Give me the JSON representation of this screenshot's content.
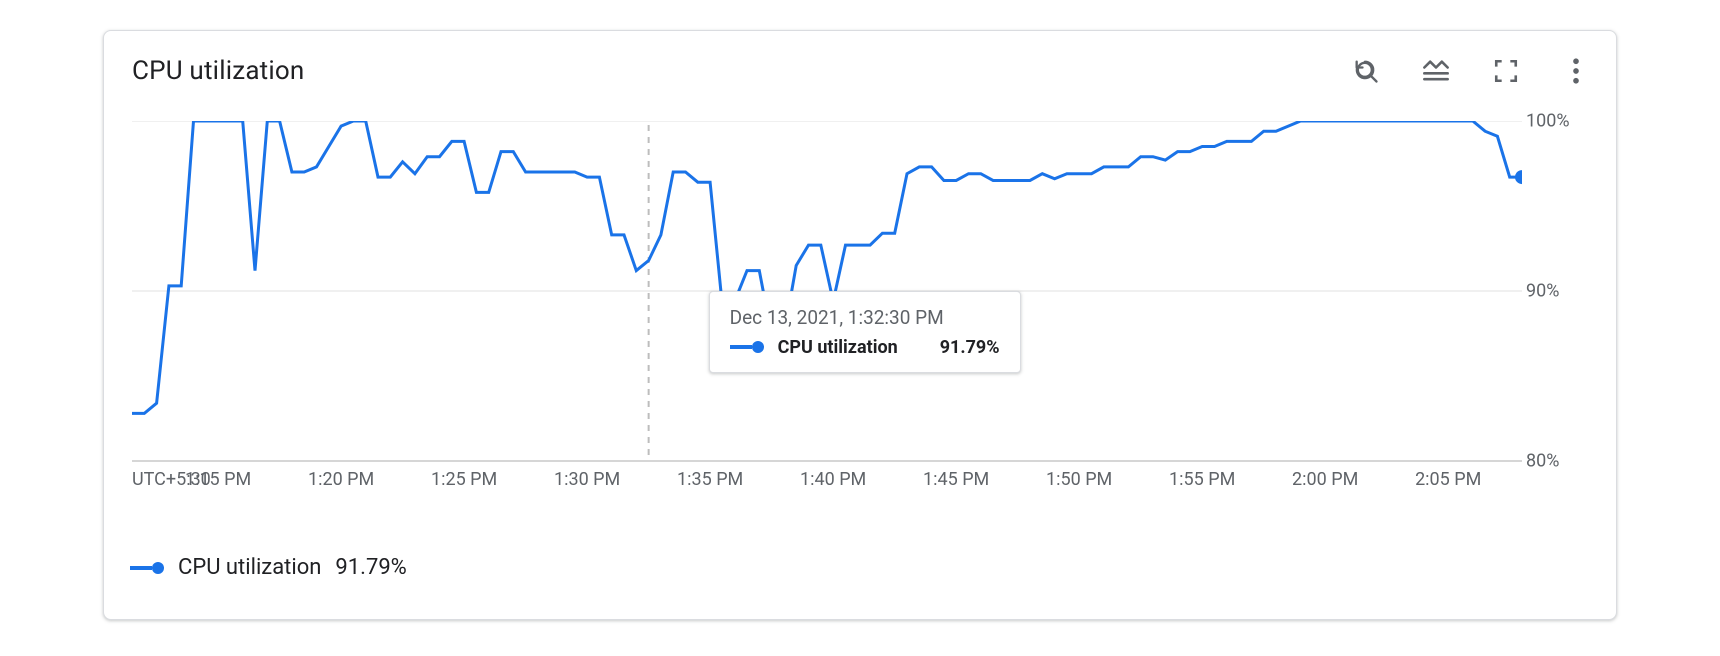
{
  "header": {
    "title": "CPU utilization",
    "tools": {
      "reset_zoom": "Reset zoom",
      "legend_toggle": "Legend",
      "fullscreen": "Full screen",
      "more": "More options"
    }
  },
  "yaxis": {
    "ticks": [
      "100%",
      "90%",
      "80%"
    ]
  },
  "xaxis": {
    "tz_label": "UTC+5:30",
    "ticks": [
      "1:15 PM",
      "1:20 PM",
      "1:25 PM",
      "1:30 PM",
      "1:35 PM",
      "1:40 PM",
      "1:45 PM",
      "1:50 PM",
      "1:55 PM",
      "2:00 PM",
      "2:05 PM"
    ]
  },
  "tooltip": {
    "time": "Dec 13, 2021, 1:32:30 PM",
    "series": "CPU utilization",
    "value": "91.79%"
  },
  "legend": {
    "series": "CPU utilization",
    "value": "91.79%"
  },
  "chart_data": {
    "type": "line",
    "title": "CPU utilization",
    "xlabel": "",
    "ylabel": "",
    "ylim": [
      80,
      100
    ],
    "x_timezone": "UTC+5:30",
    "series": [
      {
        "name": "CPU utilization",
        "color": "#1a73e8",
        "x": [
          "1:11:30 PM",
          "1:12:00 PM",
          "1:12:30 PM",
          "1:13:00 PM",
          "1:13:30 PM",
          "1:14:00 PM",
          "1:14:30 PM",
          "1:15:00 PM",
          "1:15:30 PM",
          "1:16:00 PM",
          "1:16:30 PM",
          "1:17:00 PM",
          "1:17:30 PM",
          "1:18:00 PM",
          "1:18:30 PM",
          "1:19:00 PM",
          "1:19:30 PM",
          "1:20:00 PM",
          "1:20:30 PM",
          "1:21:00 PM",
          "1:21:30 PM",
          "1:22:00 PM",
          "1:22:30 PM",
          "1:23:00 PM",
          "1:23:30 PM",
          "1:24:00 PM",
          "1:24:30 PM",
          "1:25:00 PM",
          "1:25:30 PM",
          "1:26:00 PM",
          "1:26:30 PM",
          "1:27:00 PM",
          "1:27:30 PM",
          "1:28:00 PM",
          "1:28:30 PM",
          "1:29:00 PM",
          "1:29:30 PM",
          "1:30:00 PM",
          "1:30:30 PM",
          "1:31:00 PM",
          "1:31:30 PM",
          "1:32:00 PM",
          "1:32:30 PM",
          "1:33:00 PM",
          "1:33:30 PM",
          "1:34:00 PM",
          "1:34:30 PM",
          "1:35:00 PM",
          "1:35:30 PM",
          "1:36:00 PM",
          "1:36:30 PM",
          "1:37:00 PM",
          "1:37:30 PM",
          "1:38:00 PM",
          "1:38:30 PM",
          "1:39:00 PM",
          "1:39:30 PM",
          "1:40:00 PM",
          "1:40:30 PM",
          "1:41:00 PM",
          "1:41:30 PM",
          "1:42:00 PM",
          "1:42:30 PM",
          "1:43:00 PM",
          "1:43:30 PM",
          "1:44:00 PM",
          "1:44:30 PM",
          "1:45:00 PM",
          "1:45:30 PM",
          "1:46:00 PM",
          "1:46:30 PM",
          "1:47:00 PM",
          "1:47:30 PM",
          "1:48:00 PM",
          "1:48:30 PM",
          "1:49:00 PM",
          "1:49:30 PM",
          "1:50:00 PM",
          "1:50:30 PM",
          "1:51:00 PM",
          "1:51:30 PM",
          "1:52:00 PM",
          "1:52:30 PM",
          "1:53:00 PM",
          "1:53:30 PM",
          "1:54:00 PM",
          "1:54:30 PM",
          "1:55:00 PM",
          "1:55:30 PM",
          "1:56:00 PM",
          "1:56:30 PM",
          "1:57:00 PM",
          "1:57:30 PM",
          "1:58:00 PM",
          "1:58:30 PM",
          "1:59:00 PM",
          "1:59:30 PM",
          "2:00:00 PM",
          "2:00:30 PM",
          "2:01:00 PM",
          "2:01:30 PM",
          "2:02:00 PM",
          "2:02:30 PM",
          "2:03:00 PM",
          "2:03:30 PM",
          "2:04:00 PM",
          "2:04:30 PM",
          "2:05:00 PM",
          "2:05:30 PM",
          "2:06:00 PM",
          "2:06:30 PM",
          "2:07:00 PM",
          "2:07:30 PM",
          "2:08:00 PM"
        ],
        "values": [
          82.8,
          82.8,
          83.4,
          90.3,
          90.3,
          100,
          100,
          100,
          100,
          100,
          91.2,
          100,
          100,
          97.0,
          97.0,
          97.3,
          98.5,
          99.7,
          100,
          100,
          96.7,
          96.7,
          97.6,
          96.9,
          97.9,
          97.9,
          98.8,
          98.8,
          95.8,
          95.8,
          98.2,
          98.2,
          97.0,
          97.0,
          97.0,
          97.0,
          97.0,
          96.7,
          96.7,
          93.3,
          93.3,
          91.2,
          91.79,
          93.3,
          97.0,
          97.0,
          96.4,
          96.4,
          89.1,
          89.4,
          91.2,
          91.2,
          87.4,
          87.4,
          91.5,
          92.7,
          92.7,
          89.4,
          92.7,
          92.7,
          92.7,
          93.4,
          93.4,
          96.9,
          97.3,
          97.3,
          96.5,
          96.5,
          96.9,
          96.9,
          96.5,
          96.5,
          96.5,
          96.5,
          96.9,
          96.6,
          96.9,
          96.9,
          96.9,
          97.3,
          97.3,
          97.3,
          97.9,
          97.9,
          97.7,
          98.2,
          98.2,
          98.5,
          98.5,
          98.8,
          98.8,
          98.8,
          99.4,
          99.4,
          99.7,
          100,
          100,
          100,
          100,
          100,
          100,
          100,
          100,
          100,
          100,
          100,
          100,
          100,
          100,
          100,
          99.4,
          99.1,
          96.7,
          96.7
        ]
      }
    ],
    "hover": {
      "x": "1:32:30 PM",
      "CPU utilization": 91.79
    }
  }
}
